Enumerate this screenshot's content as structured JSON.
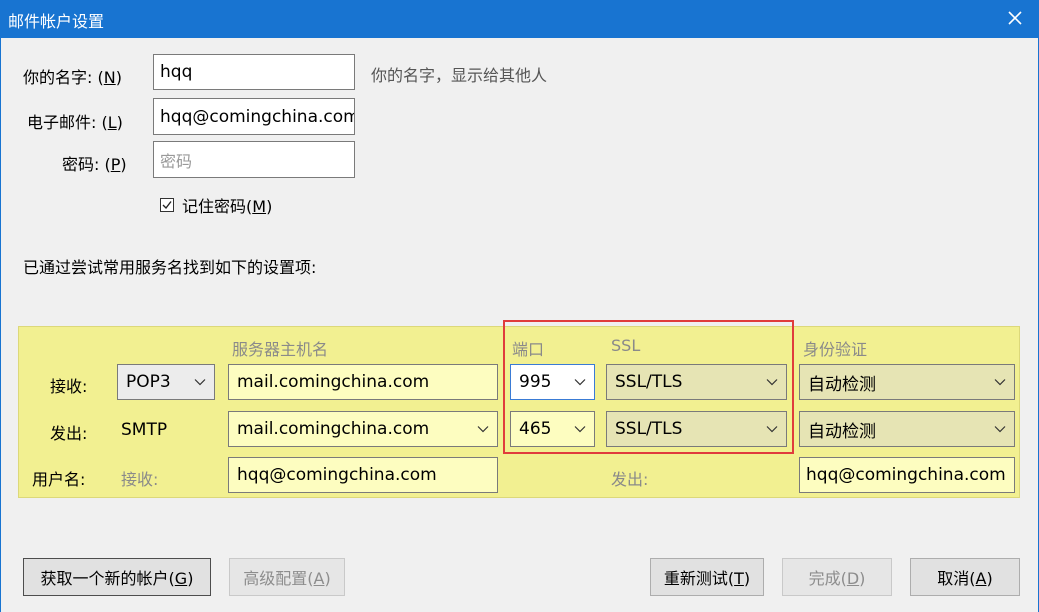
{
  "dialog": {
    "title": "邮件帐户设置"
  },
  "account": {
    "name_label": "你的名字:",
    "name_key": "N",
    "name_value": "hqq",
    "name_hint": "你的名字，显示给其他人",
    "email_label": "电子邮件:",
    "email_key": "L",
    "email_value": "hqq@comingchina.com",
    "password_label": "密码:",
    "password_key": "P",
    "password_placeholder": "密码",
    "remember_label": "记住密码(",
    "remember_key": "M",
    "remember_checked": true
  },
  "found_text": "已通过尝试常用服务名找到如下的设置项:",
  "server": {
    "headers": {
      "hostname": "服务器主机名",
      "port": "端口",
      "ssl": "SSL",
      "auth": "身份验证"
    },
    "incoming": {
      "label": "接收:",
      "protocol": "POP3",
      "host": "mail.comingchina.com",
      "port": "995",
      "ssl": "SSL/TLS",
      "auth": "自动检测"
    },
    "outgoing": {
      "label": "发出:",
      "protocol": "SMTP",
      "host": "mail.comingchina.com",
      "port": "465",
      "ssl": "SSL/TLS",
      "auth": "自动检测"
    },
    "username": {
      "label": "用户名:",
      "incoming_label": "接收:",
      "incoming_value": "hqq@comingchina.com",
      "outgoing_label": "发出:",
      "outgoing_value": "hqq@comingchina.com"
    }
  },
  "buttons": {
    "new_account": "获取一个新的帐户(",
    "new_account_key": "G",
    "advanced": "高级配置(",
    "advanced_key": "A",
    "retest": "重新测试(",
    "retest_key": "T",
    "done": "完成(",
    "done_key": "D",
    "cancel": "取消(",
    "cancel_key": "A"
  }
}
